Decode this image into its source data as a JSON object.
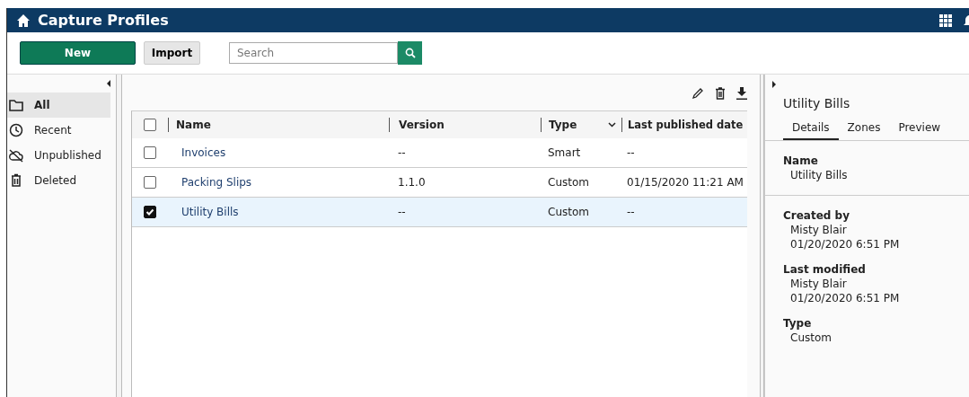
{
  "header": {
    "title": "Capture Profiles"
  },
  "toolbar": {
    "new_button": "New",
    "import_button": "Import",
    "search": {
      "placeholder": "Search"
    }
  },
  "sidebar": {
    "items": [
      {
        "label": "All",
        "selected": true
      },
      {
        "label": "Recent",
        "selected": false
      },
      {
        "label": "Unpublished",
        "selected": false
      },
      {
        "label": "Deleted",
        "selected": false
      }
    ]
  },
  "table": {
    "select_all_checked": false,
    "columns": [
      "Name",
      "Version",
      "Type",
      "Last published date"
    ],
    "rows": [
      {
        "checked": false,
        "selected": false,
        "cells": [
          "Invoices",
          "--",
          "Smart",
          "--"
        ]
      },
      {
        "checked": false,
        "selected": false,
        "cells": [
          "Packing Slips",
          "1.1.0",
          "Custom",
          "01/15/2020 11:21 AM"
        ]
      },
      {
        "checked": true,
        "selected": true,
        "cells": [
          "Utility Bills",
          "--",
          "Custom",
          "--"
        ]
      }
    ]
  },
  "details": {
    "title": "Utility Bills",
    "tabs": [
      {
        "label": "Details",
        "selected": true
      },
      {
        "label": "Zones",
        "selected": false
      },
      {
        "label": "Preview",
        "selected": false
      }
    ],
    "sections": [
      {
        "fields": [
          {
            "label": "Name",
            "lines": [
              "Utility Bills"
            ]
          }
        ]
      },
      {
        "fields": [
          {
            "label": "Created by",
            "lines": [
              "Misty Blair",
              "01/20/2020 6:51 PM"
            ]
          },
          {
            "label": "Last modified",
            "lines": [
              "Misty Blair",
              "01/20/2020 6:51 PM"
            ]
          },
          {
            "label": "Type",
            "lines": [
              "Custom"
            ]
          }
        ]
      }
    ]
  }
}
